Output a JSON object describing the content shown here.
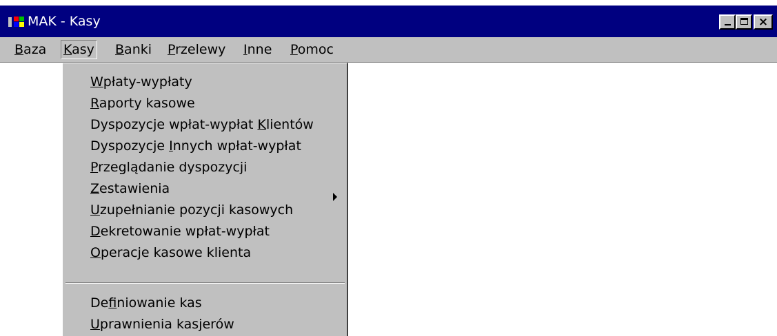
{
  "window": {
    "title": "MAK - Kasy",
    "icon": "windows-flag-icon",
    "controls": {
      "minimize": "minimize-icon",
      "maximize": "maximize-icon",
      "close": "×"
    }
  },
  "menubar": {
    "items": [
      {
        "pre": "",
        "key": "B",
        "post": "aza",
        "active": false
      },
      {
        "pre": "",
        "key": "K",
        "post": "asy",
        "active": true
      },
      {
        "pre": "",
        "key": "B",
        "post": "anki",
        "active": false
      },
      {
        "pre": "",
        "key": "P",
        "post": "rzelewy",
        "active": false
      },
      {
        "pre": "",
        "key": "I",
        "post": "nne",
        "active": false
      },
      {
        "pre": "",
        "key": "P",
        "post": "omoc",
        "active": false
      }
    ]
  },
  "kasy_menu": {
    "items": [
      {
        "pre": "",
        "key": "W",
        "post": "płaty-wypłaty",
        "submenu": false
      },
      {
        "pre": "",
        "key": "R",
        "post": "aporty kasowe",
        "submenu": false
      },
      {
        "pre": "Dyspozycje wpłat-wypłat ",
        "key": "K",
        "post": "lientów",
        "submenu": false
      },
      {
        "pre": "Dyspozycje ",
        "key": "I",
        "post": "nnych wpłat-wypłat",
        "submenu": false
      },
      {
        "pre": "",
        "key": "P",
        "post": "rzeglądanie dyspozycji",
        "submenu": false
      },
      {
        "pre": "",
        "key": "Z",
        "post": "estawienia",
        "submenu": true
      },
      {
        "pre": "",
        "key": "U",
        "post": "zupełnianie pozycji kasowych",
        "submenu": false
      },
      {
        "pre": "",
        "key": "D",
        "post": "ekretowanie wpłat-wypłat",
        "submenu": false
      },
      {
        "pre": "",
        "key": "O",
        "post": "peracje kasowe klienta",
        "submenu": false
      },
      {
        "pre": "De",
        "key": "f",
        "post": "iniowanie kas",
        "submenu": false
      },
      {
        "pre": "",
        "key": "U",
        "post": "prawnienia kasjerów",
        "submenu": false
      }
    ]
  },
  "colors": {
    "titlebar": "#000080",
    "menu_bg": "#c0c0c0",
    "workspace": "#ffffff"
  }
}
